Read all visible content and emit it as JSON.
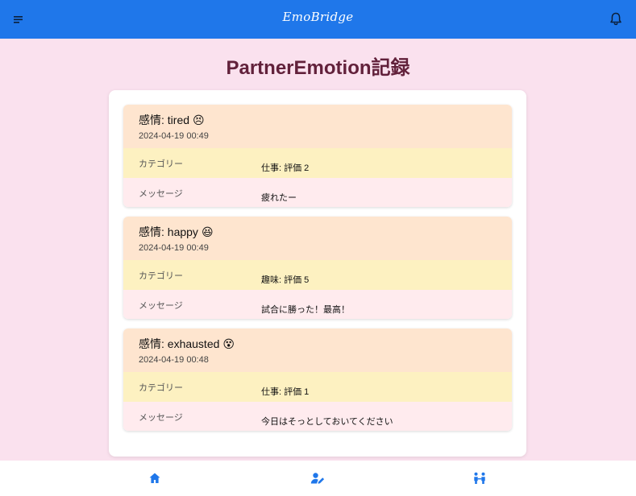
{
  "app": {
    "logo": "EmoBridge"
  },
  "header": {
    "menu_icon": "hamburger-menu-icon",
    "notification_icon": "bell-icon"
  },
  "page": {
    "title": "PartnerEmotion記録"
  },
  "records": [
    {
      "emotion_label": "感情: tired",
      "emoji": "😣",
      "datetime": "2024-04-19 00:49",
      "category_label": "カテゴリー",
      "category_value": "仕事: 評価 2",
      "message_label": "メッセージ",
      "message_value": "疲れたー"
    },
    {
      "emotion_label": "感情: happy",
      "emoji": "😆",
      "datetime": "2024-04-19 00:49",
      "category_label": "カテゴリー",
      "category_value": "趣味: 評価 5",
      "message_label": "メッセージ",
      "message_value": "試合に勝った！最高！"
    },
    {
      "emotion_label": "感情: exhausted",
      "emoji": "😵",
      "datetime": "2024-04-19 00:48",
      "category_label": "カテゴリー",
      "category_value": "仕事: 評価 1",
      "message_label": "メッセージ",
      "message_value": "今日はそっとしておいてください"
    }
  ],
  "bottom_nav": [
    {
      "icon": "home-icon"
    },
    {
      "icon": "user-edit-icon"
    },
    {
      "icon": "partners-icon"
    }
  ],
  "colors": {
    "topbar": "#1f77ea",
    "page_bg": "#fae1ee",
    "title": "#62213b",
    "card_header": "#fee5cf",
    "category_row": "#fdf1c1",
    "message_row": "#ffebee",
    "nav_icon": "#1f77ea"
  }
}
